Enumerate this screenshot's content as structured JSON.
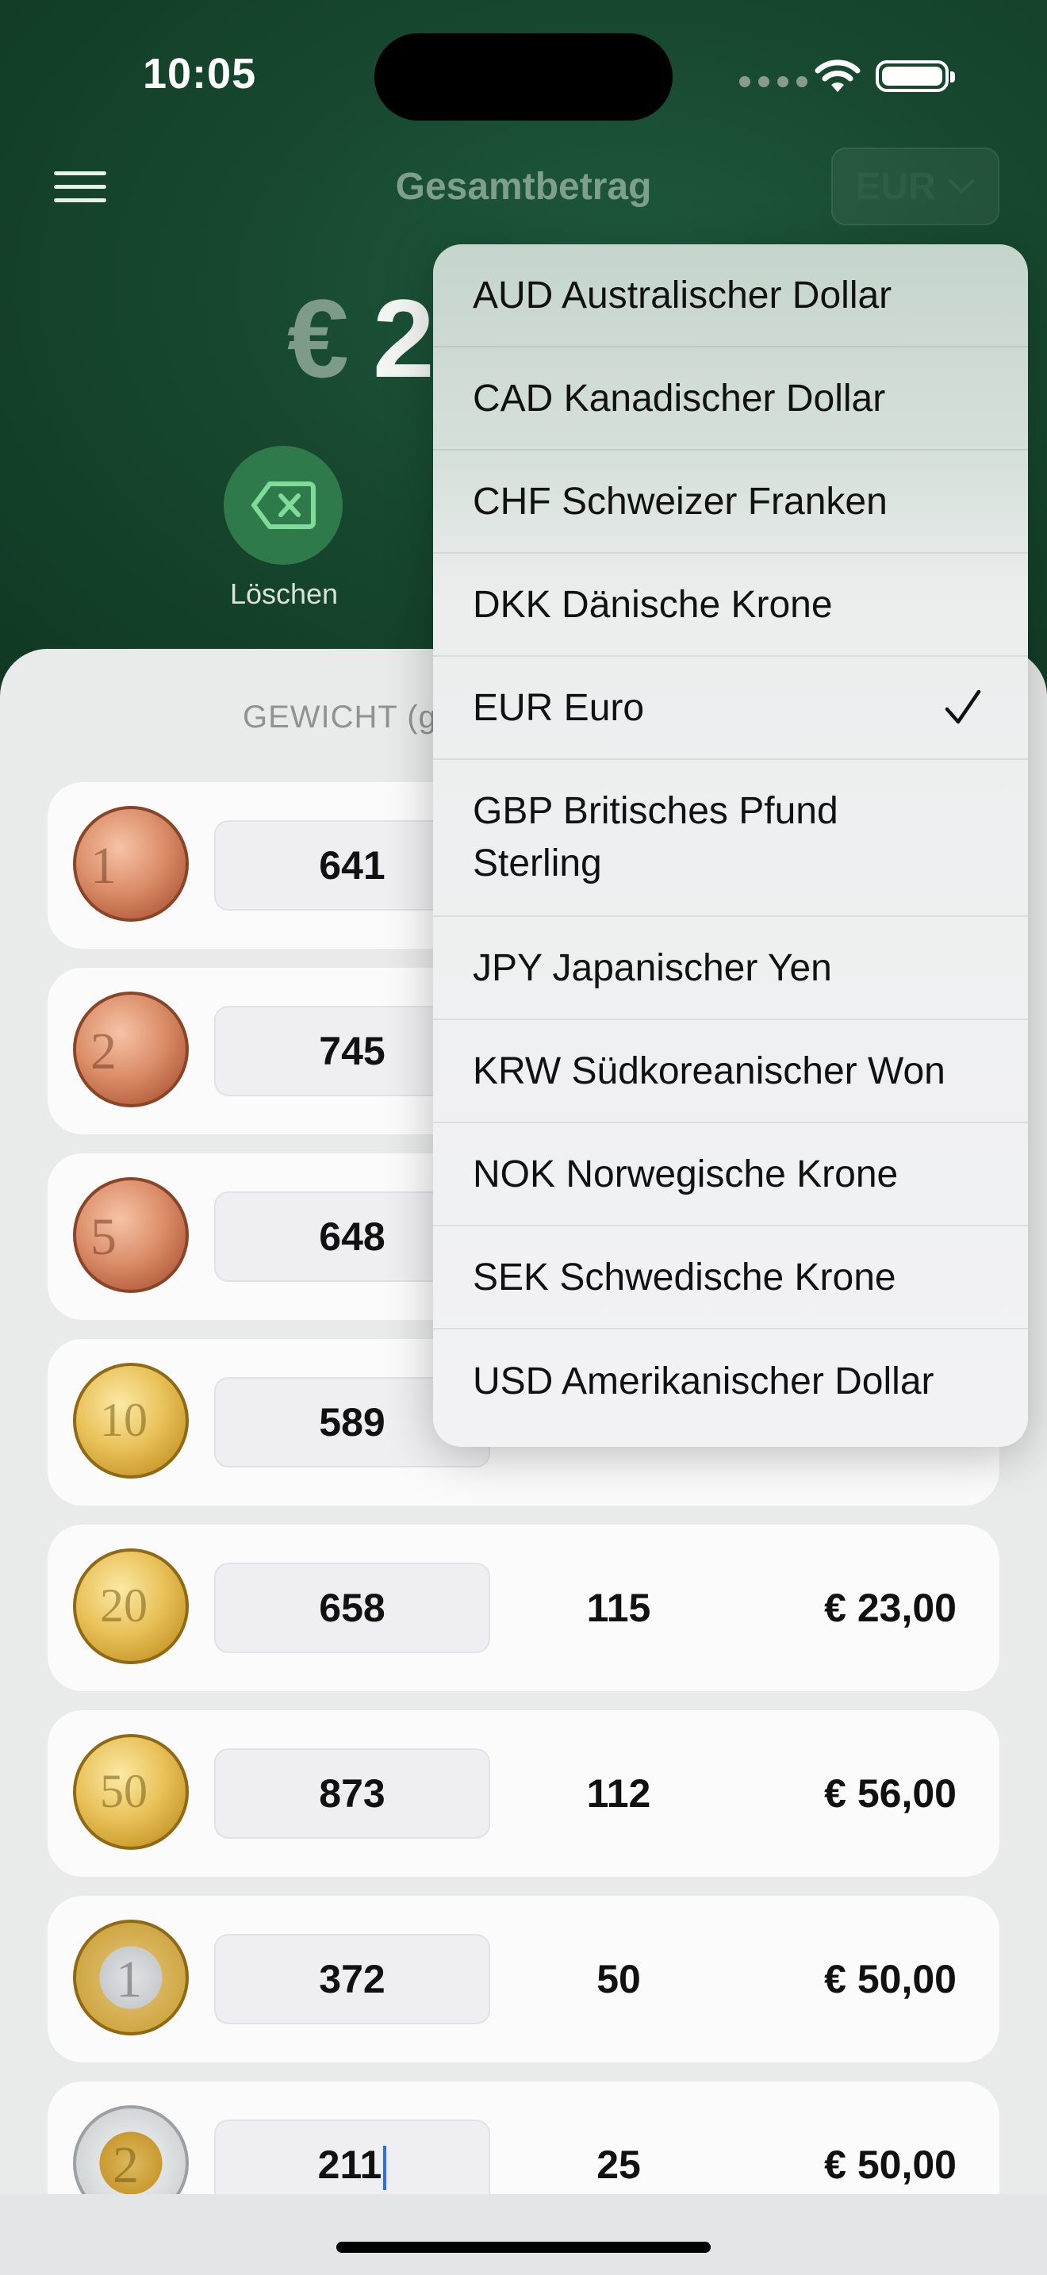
{
  "status_bar": {
    "time": "10:05"
  },
  "header": {
    "title": "Gesamtbetrag",
    "currency_button": "EUR",
    "total_symbol": "€",
    "total_visible": "2",
    "delete_label": "Löschen"
  },
  "table": {
    "header_weight": "GEWICHT (g",
    "rows": [
      {
        "coin": "1 cent",
        "weight": "641",
        "count": "",
        "amount": ""
      },
      {
        "coin": "2 cent",
        "weight": "745",
        "count": "",
        "amount": ""
      },
      {
        "coin": "5 cent",
        "weight": "648",
        "count": "",
        "amount": ""
      },
      {
        "coin": "10 cent",
        "weight": "589",
        "count": "",
        "amount": ""
      },
      {
        "coin": "20 cent",
        "weight": "658",
        "count": "115",
        "amount": "€ 23,00"
      },
      {
        "coin": "50 cent",
        "weight": "873",
        "count": "112",
        "amount": "€ 56,00"
      },
      {
        "coin": "1 euro",
        "weight": "372",
        "count": "50",
        "amount": "€ 50,00"
      },
      {
        "coin": "2 euro",
        "weight": "211",
        "count": "25",
        "amount": "€ 50,00"
      }
    ]
  },
  "currency_menu": {
    "items": [
      {
        "label": "AUD Australischer Dollar",
        "selected": false
      },
      {
        "label": "CAD Kanadischer Dollar",
        "selected": false
      },
      {
        "label": "CHF Schweizer Franken",
        "selected": false
      },
      {
        "label": "DKK Dänische Krone",
        "selected": false
      },
      {
        "label": "EUR Euro",
        "selected": true
      },
      {
        "label": "GBP Britisches Pfund Sterling",
        "selected": false
      },
      {
        "label": "JPY Japanischer Yen",
        "selected": false
      },
      {
        "label": "KRW Südkoreanischer Won",
        "selected": false
      },
      {
        "label": "NOK Norwegische Krone",
        "selected": false
      },
      {
        "label": "SEK Schwedische Krone",
        "selected": false
      },
      {
        "label": "USD Amerikanischer Dollar",
        "selected": false
      }
    ]
  },
  "colors": {
    "header_green": "#17482f",
    "delete_green": "#2f7a4a",
    "checkmark": "#111111"
  }
}
